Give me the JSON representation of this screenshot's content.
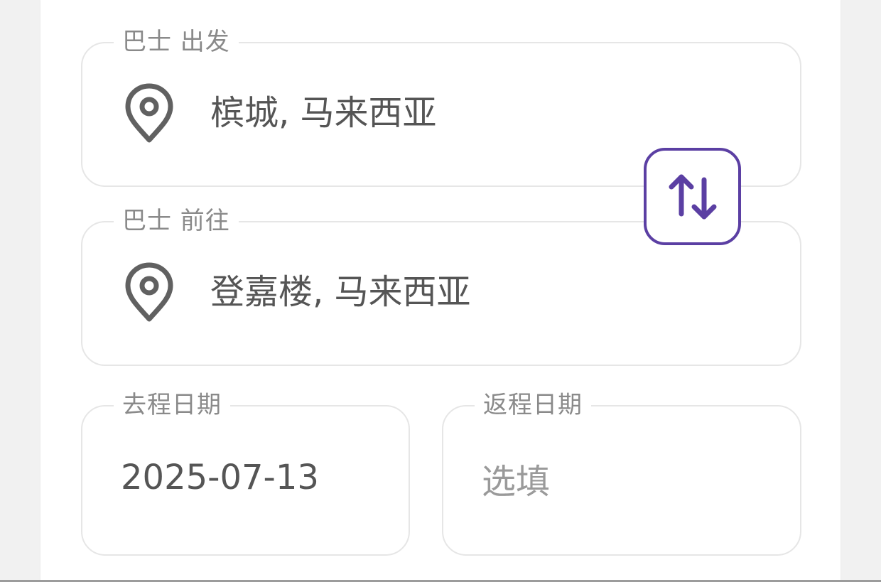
{
  "from_field": {
    "label": "巴士 出发",
    "value": "槟城, 马来西亚",
    "icon": "location-pin-icon"
  },
  "to_field": {
    "label": "巴士 前往",
    "value": "登嘉楼, 马来西亚",
    "icon": "location-pin-icon"
  },
  "swap_button": {
    "icon": "swap-vertical-icon",
    "color": "#5b3fa3"
  },
  "depart_date": {
    "label": "去程日期",
    "value": "2025-07-13"
  },
  "return_date": {
    "label": "返程日期",
    "placeholder": "选填"
  }
}
